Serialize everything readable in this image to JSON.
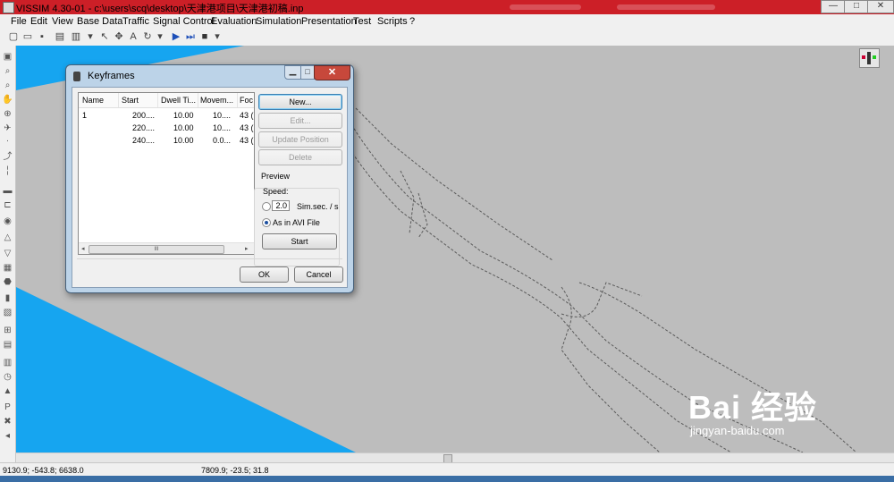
{
  "window": {
    "title": "VISSIM 4.30-01 - c:\\users\\scq\\desktop\\天津港项目\\天津港初稿.inp",
    "controls": [
      "—",
      "□",
      "✕"
    ]
  },
  "menu": [
    {
      "label": "File",
      "enabled": true
    },
    {
      "label": "Edit",
      "enabled": true
    },
    {
      "label": "View",
      "enabled": true
    },
    {
      "label": "Base Data",
      "enabled": true
    },
    {
      "label": "Traffic",
      "enabled": true
    },
    {
      "label": "Signal Control",
      "enabled": true
    },
    {
      "label": "Evaluation",
      "enabled": true
    },
    {
      "label": "Simulation",
      "enabled": true
    },
    {
      "label": "Presentation",
      "enabled": true
    },
    {
      "label": "Test",
      "enabled": true
    },
    {
      "label": "Scripts",
      "enabled": true
    },
    {
      "label": "?",
      "enabled": true
    }
  ],
  "dialog": {
    "title": "Keyframes",
    "columns": [
      "Name",
      "Start",
      "Dwell Ti...",
      "Movem...",
      "Foc"
    ],
    "rows": [
      [
        "1",
        "200....",
        "10.00",
        "10....",
        "43 ("
      ],
      [
        "",
        "220....",
        "10.00",
        "10....",
        "43 ("
      ],
      [
        "",
        "240....",
        "10.00",
        "0.0...",
        "43 ("
      ]
    ],
    "scroll_grip": "III",
    "buttons": {
      "new": "New...",
      "edit": "Edit...",
      "update": "Update Position",
      "delete": "Delete",
      "start": "Start",
      "ok": "OK",
      "cancel": "Cancel"
    },
    "preview": {
      "group_label": "Preview",
      "speed_label": "Speed:",
      "speed_value": "2.0",
      "speed_unit": "Sim.sec. / s",
      "avi_label": "As in AVI File",
      "selected": "avi"
    }
  },
  "status": {
    "left": "9130.9; -543.8; 6638.0",
    "right": "7809.9; -23.5; 31.8"
  },
  "watermark": {
    "main": "Bai 经验",
    "url": "jingyan-baidu.com"
  },
  "colors": {
    "titlebar": "#cc1f27",
    "canvas_bg": "#16a5f0",
    "plane": "#bdbdbd",
    "dialog_frame": "#bcd3e8"
  }
}
